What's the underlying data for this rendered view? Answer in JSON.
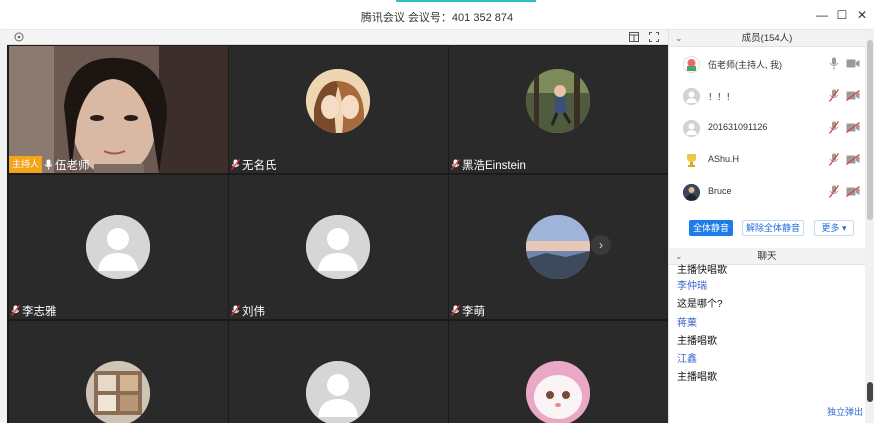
{
  "window": {
    "title": "腾讯会议  会议号：401 352 874",
    "min_label": "—",
    "max_label": "☐",
    "close_label": "✕",
    "menu_label": "⋮",
    "accent_color": "#2ec0c0"
  },
  "video": {
    "tiles": [
      {
        "name": "伍老师",
        "host_badge": "主持人",
        "avatar": "camera-feed-woman"
      },
      {
        "name": "无名氏",
        "avatar": "anime-couple"
      },
      {
        "name": "黑浩Einstein",
        "avatar": "child-running"
      },
      {
        "name": "李志雅",
        "avatar": "default-person"
      },
      {
        "name": "刘伟",
        "avatar": "default-person"
      },
      {
        "name": "李萌",
        "avatar": "sunset-sky"
      },
      {
        "name": "",
        "avatar": "toy-shelf"
      },
      {
        "name": "",
        "avatar": "default-person"
      },
      {
        "name": "",
        "avatar": "white-cat"
      }
    ],
    "next_arrow": "›"
  },
  "members": {
    "header": "成员(154人)",
    "list": [
      {
        "name": "伍老师(主持人, 我)",
        "avatar": "cartoon-avatar",
        "muted": false
      },
      {
        "name": "！！！",
        "avatar": "default-person",
        "muted": true
      },
      {
        "name": "201631091126",
        "avatar": "default-person",
        "muted": true
      },
      {
        "name": "AShu.H",
        "avatar": "trophy-avatar",
        "muted": true
      },
      {
        "name": "Bruce",
        "avatar": "photo-avatar",
        "muted": true
      }
    ],
    "buttons": {
      "mute_all": "全体静音",
      "unmute_all": "解除全体静音",
      "more": "更多 ▾"
    }
  },
  "chat": {
    "header": "聊天",
    "partial_top": "主播快唱歌",
    "messages": [
      {
        "sender": "李仲瑞",
        "text": "这是哪个?"
      },
      {
        "sender": "蒋菓",
        "text": "主播唱歌"
      },
      {
        "sender": "江鑫",
        "text": "主播唱歌"
      }
    ],
    "popout": "独立弹出"
  },
  "colors": {
    "primary_button": "#1e7ce8",
    "host_badge": "#f2a51c",
    "sender_name": "#3b63c9"
  }
}
